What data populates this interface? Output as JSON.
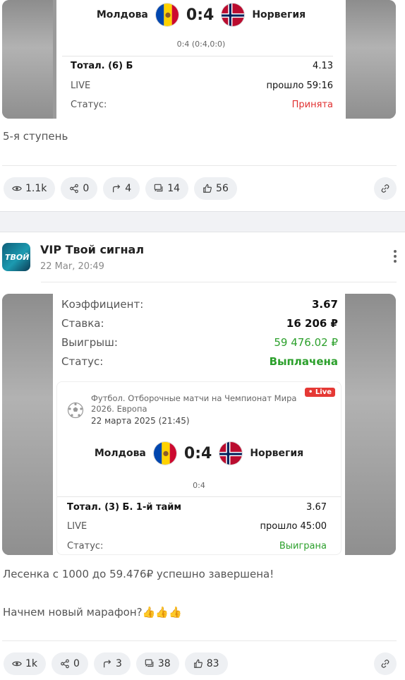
{
  "post1": {
    "match": {
      "home": "Молдова",
      "score": "0:4",
      "away": "Норвегия",
      "sub": "0:4 (0:4,0:0)"
    },
    "bet": {
      "market": "Тотал. (6) Б",
      "odds": "4.13",
      "live_label": "LIVE",
      "time": "прошло 59:16",
      "status_label": "Статус:",
      "status": "Принята"
    },
    "caption": "5-я ступень",
    "actions": {
      "views": "1.1k",
      "shares": "0",
      "reposts": "4",
      "comments": "14",
      "likes": "56"
    }
  },
  "post2": {
    "author": {
      "name": "VIP Твой сигнал",
      "date": "22 Mar, 20:49",
      "avatar_text": "ТВОЙ"
    },
    "summary": {
      "coef_label": "Коэффициент:",
      "coef": "3.67",
      "stake_label": "Ставка:",
      "stake": "16 206 ₽",
      "win_label": "Выигрыш:",
      "win": "59 476.02 ₽",
      "status_label": "Статус:",
      "status": "Выплачена"
    },
    "event": {
      "live_badge": "• Live",
      "title": "Футбол. Отборочные матчи на Чемпионат Мира 2026. Европа",
      "date": "22 марта 2025 (21:45)"
    },
    "match": {
      "home": "Молдова",
      "score": "0:4",
      "away": "Норвегия",
      "sub": "0:4"
    },
    "bet": {
      "market": "Тотал. (3) Б. 1-й тайм",
      "odds": "3.67",
      "live_label": "LIVE",
      "time": "прошло 45:00",
      "status_label": "Статус:",
      "status": "Выиграна"
    },
    "caption1": "Лесенка с 1000 до 59.476₽ успешно завершена!",
    "caption2": "Начнем новый марафон?👍👍👍",
    "actions": {
      "views": "1k",
      "shares": "0",
      "reposts": "3",
      "comments": "38",
      "likes": "83"
    }
  },
  "colors": {
    "accent_green": "#2ca02c",
    "accent_red": "#e03030",
    "chip_bg": "#eef0f3"
  }
}
